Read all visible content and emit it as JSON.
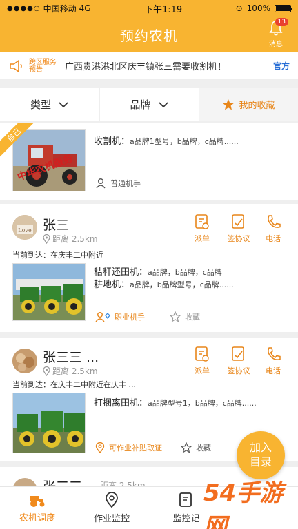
{
  "status_bar": {
    "carrier": "中国移动",
    "network": "4G",
    "time": "下午1:19",
    "battery": "100%",
    "battery_level": 1.0
  },
  "header": {
    "title": "预约农机",
    "messages_label": "消息",
    "messages_count": "13"
  },
  "notice": {
    "tag_line1": "跨区服务",
    "tag_line2": "预告",
    "text": "广西贵港港北区庆丰镇张三需要收割机！",
    "official": "官方"
  },
  "filters": {
    "type": "类型",
    "brand": "品牌",
    "favorites": "我的收藏"
  },
  "cards": [
    {
      "ribbon": "自己",
      "photo_caption": "中华农机服务",
      "machine_label": "收割机：",
      "machine_brands": "a品牌1型号，b品牌，c品牌......",
      "operator": "普通机手"
    },
    {
      "name": "张三",
      "distance": "距离 2.5km",
      "actions": [
        "派单",
        "签协议",
        "电话"
      ],
      "location": "当前到达：在庆丰二中附近",
      "lines": [
        {
          "label": "秸秆还田机：",
          "brands": "a品牌，b品牌，c品牌"
        },
        {
          "label": "耕地机：",
          "brands": "a品牌，b品牌型号，c品牌......"
        }
      ],
      "operator": "职业机手",
      "favorite": "收藏"
    },
    {
      "name": "张三三 ...",
      "distance": "距离 2.5km",
      "actions": [
        "派单",
        "签协议",
        "电话"
      ],
      "location": "当前到达：在庆丰二中附近在庆丰 ...",
      "lines": [
        {
          "label": "打捆离田机：",
          "brands": "a品牌型号1，b品牌，c品牌......"
        }
      ],
      "operator": "可作业补贴取证",
      "favorite": "收藏"
    },
    {
      "name": "张三三",
      "distance": "距离 2.5km"
    }
  ],
  "fab": {
    "line1": "加入",
    "line2": "目录"
  },
  "tabbar": [
    {
      "label": "农机调度",
      "icon": "tractor-icon"
    },
    {
      "label": "作业监控",
      "icon": "location-pin-icon"
    },
    {
      "label": "监控记",
      "icon": "record-icon"
    }
  ],
  "watermark": "54手游网",
  "colors": {
    "brand": "#f8b431",
    "accent": "#e8861a",
    "link": "#2a6fd6"
  }
}
